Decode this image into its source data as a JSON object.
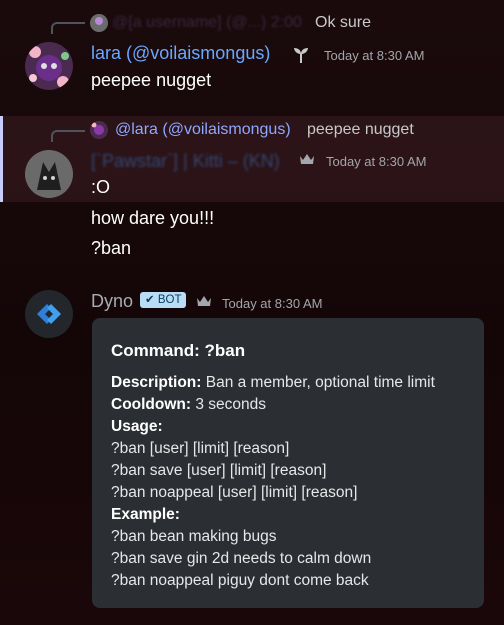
{
  "messages": {
    "first": {
      "reply_obscured": "@[a username] (@...) 2:00",
      "reply_text": "Ok sure",
      "author": "lara (@voilaismongus)",
      "timestamp": "Today at 8:30 AM",
      "text": "peepee nugget"
    },
    "second": {
      "reply_mention": "@lara (@voilaismongus)",
      "reply_text": "peepee nugget",
      "author_obscured": "[`Pawstar`] | Kitti – (KN)",
      "timestamp": "Today at 8:30 AM",
      "lines": [
        ":O",
        "how dare you!!!",
        "?ban"
      ]
    },
    "dyno": {
      "author": "Dyno",
      "bot_badge": "✔ BOT",
      "timestamp": "Today at 8:30 AM",
      "embed": {
        "title": "Command: ?ban",
        "description_label": "Description:",
        "description": "Ban a member, optional time limit",
        "cooldown_label": "Cooldown:",
        "cooldown": "3 seconds",
        "usage_label": "Usage:",
        "usage": [
          "?ban [user] [limit] [reason]",
          "?ban save [user] [limit] [reason]",
          "?ban noappeal [user] [limit] [reason]"
        ],
        "example_label": "Example:",
        "examples": [
          "?ban bean making bugs",
          "?ban save gin 2d needs to calm down",
          "?ban noappeal piguy dont come back"
        ]
      }
    }
  },
  "colors": {
    "lara_name": "#6aa8ff",
    "second_name": "#3a6bb0",
    "mention": "#8fa7ff",
    "dyno_name": "#a8abb0",
    "embed_bg": "#2b2f33"
  }
}
